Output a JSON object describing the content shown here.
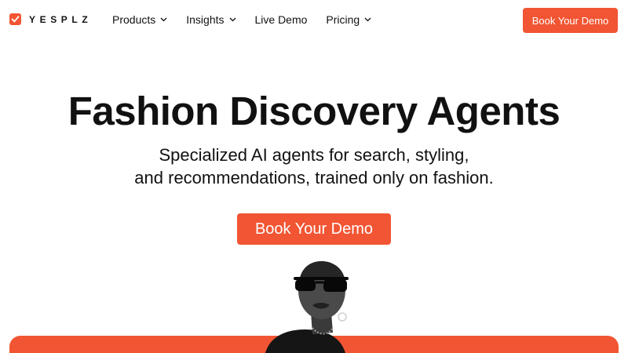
{
  "header": {
    "logo_text": "YESPLZ",
    "nav": [
      {
        "label": "Products",
        "dropdown": true
      },
      {
        "label": "Insights",
        "dropdown": true
      },
      {
        "label": "Live Demo",
        "dropdown": false
      },
      {
        "label": "Pricing",
        "dropdown": true
      }
    ],
    "cta_label": "Book Your Demo"
  },
  "hero": {
    "title": "Fashion Discovery Agents",
    "subtitle_line1": "Specialized AI agents for search, styling,",
    "subtitle_line2": "and recommendations, trained only on fashion.",
    "cta_label": "Book Your Demo"
  },
  "colors": {
    "accent": "#f25533",
    "text": "#111111",
    "background": "#ffffff"
  },
  "icons": {
    "logo": "logo-mark-icon",
    "dropdown": "chevron-down-icon"
  }
}
